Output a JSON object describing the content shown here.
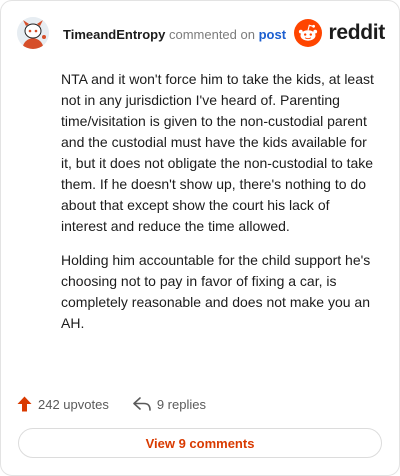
{
  "comment": {
    "author": "TimeandEntropy",
    "action": "commented on",
    "post_link": "post",
    "paragraphs": [
      "NTA and it won't force him to take the kids, at least not in any jurisdiction I've heard of. Parenting time/visitation is given to the non-custodial parent and the custodial must have the kids available for it, but it does not obligate the non-custodial to take them. If he doesn't show up, there's nothing to do about that except show the court his lack of interest and reduce the time allowed.",
      "Holding him accountable for the child support he's choosing not to pay in favor of fixing a car, is completely reasonable and does not make you an AH."
    ]
  },
  "brand": {
    "wordmark": "reddit",
    "accent": "#ff4500"
  },
  "stats": {
    "upvotes": "242 upvotes",
    "replies": "9 replies",
    "upvote_icon": "upvote-arrow-icon",
    "reply_icon": "reply-arrow-icon"
  },
  "actions": {
    "view_comments": "View 9 comments"
  }
}
